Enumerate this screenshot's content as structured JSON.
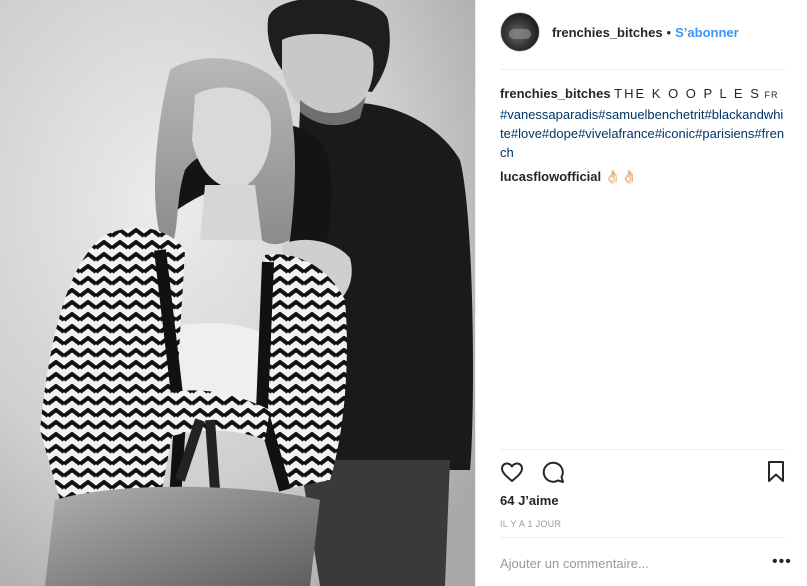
{
  "post": {
    "username": "frenchies_bitches",
    "separator": "•",
    "follow_label": "S’abonner",
    "caption": {
      "user": "frenchies_bitches",
      "brand": "THE K O O P L E S",
      "brand_suffix": "FR",
      "tags": [
        "#vanessaparadis",
        "#samuelbenchetrit",
        "#blackandwhite",
        "#love",
        "#dope",
        "#vivelafrance",
        "#iconic",
        "#parisiens",
        "#french"
      ]
    },
    "comment": {
      "user": "lucasflowofficial",
      "text": "👌🏻👌🏻"
    },
    "likes_text": "64 J’aime",
    "time_text": "IL Y A 1 JOUR",
    "add_comment_placeholder": "Ajouter un commentaire...",
    "more_options": "•••"
  },
  "icons": [
    "heart-icon",
    "comment-icon",
    "bookmark-icon",
    "more-options-icon"
  ],
  "colors": {
    "link_blue": "#3897f0",
    "hashtag_blue": "#003569",
    "text": "#262626",
    "muted": "#999999",
    "border": "#efefef"
  }
}
